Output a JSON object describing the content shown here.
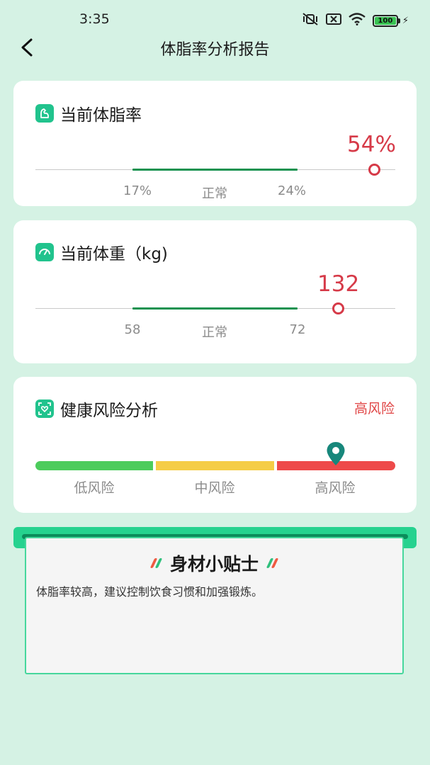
{
  "status_bar": {
    "time": "3:35",
    "battery_label": "100",
    "icons": [
      "mute-vibrate-icon",
      "sim-x-icon",
      "wifi-icon",
      "battery-icon",
      "charging-icon"
    ]
  },
  "nav": {
    "title": "体脂率分析报告",
    "back_icon": "chevron-left-icon"
  },
  "body_fat": {
    "title": "当前体脂率",
    "value": "54%",
    "low_label": "17%",
    "normal_label": "正常",
    "high_label": "24%"
  },
  "weight": {
    "title": "当前体重（kg)",
    "value": "132",
    "low_label": "58",
    "normal_label": "正常",
    "high_label": "72"
  },
  "risk": {
    "title": "健康风险分析",
    "level": "高风险",
    "segments": [
      "低风险",
      "中风险",
      "高风险"
    ],
    "colors": {
      "low": "#4ccc5c",
      "mid": "#f5cd46",
      "high": "#ee4a4a"
    }
  },
  "tips": {
    "title": "身材小贴士",
    "text": "体脂率较高，建议控制饮食习惯和加强锻炼。"
  },
  "colors": {
    "background": "#d5f2e4",
    "accent_green": "#21c38d",
    "alert_red": "#d63a48",
    "normal_range": "#179250"
  }
}
